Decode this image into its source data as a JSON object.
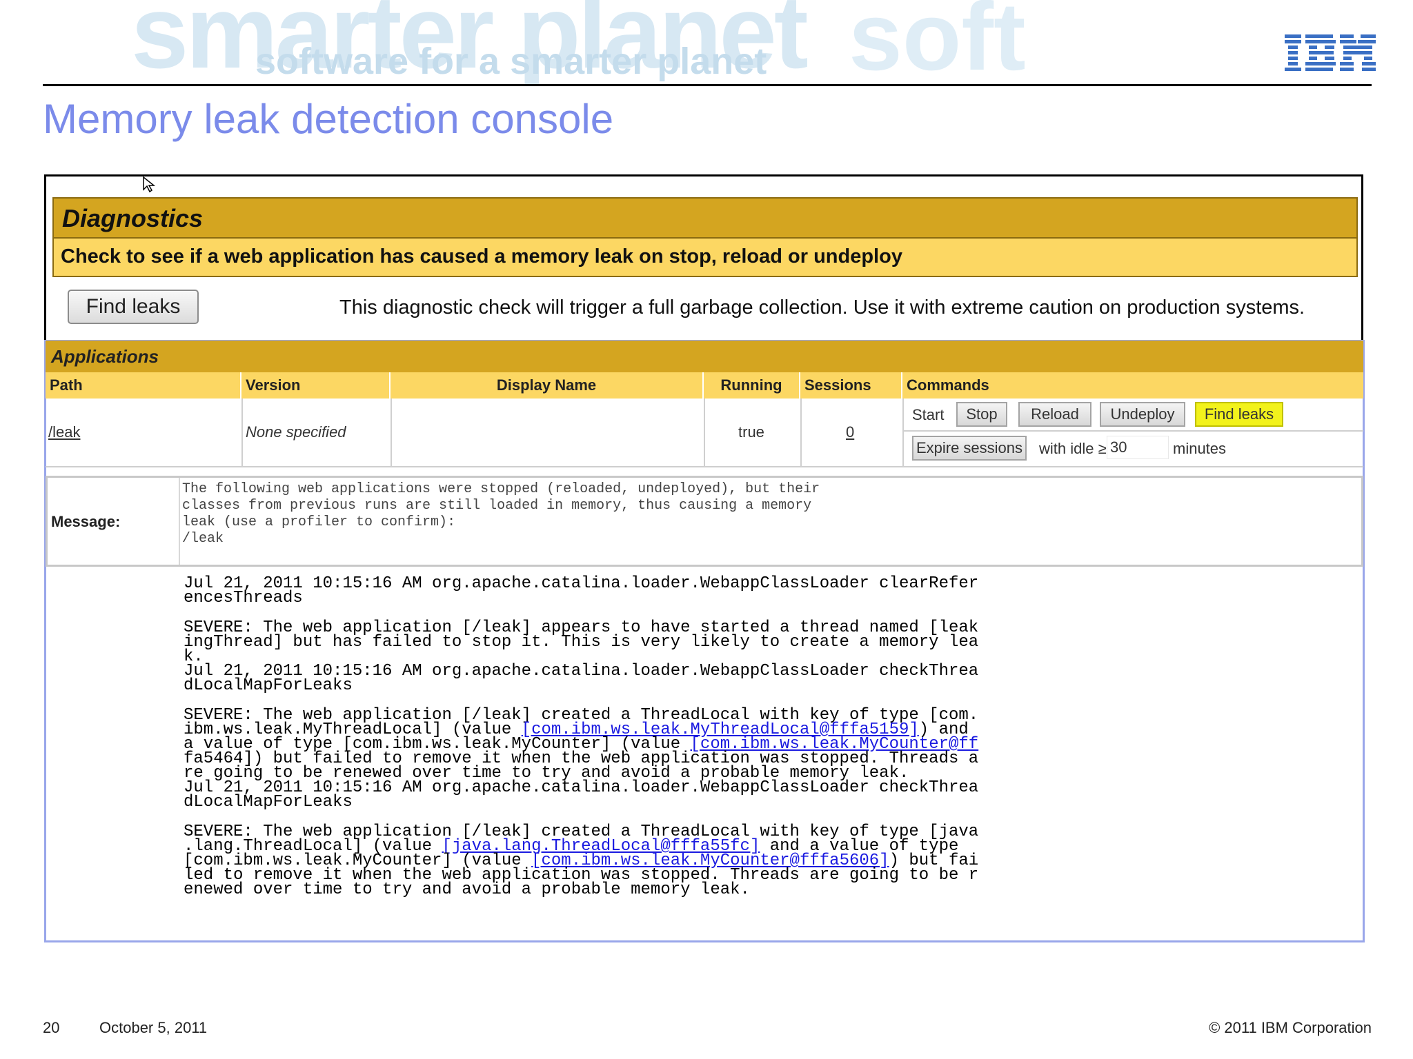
{
  "header": {
    "watermark_big": "smarter planet",
    "watermark_small": "software for a smarter planet",
    "watermark_right": "soft",
    "logo": "IBM",
    "title": "Memory leak detection console"
  },
  "diagnostics": {
    "heading": "Diagnostics",
    "subheading": "Check to see if a web application has caused a memory leak on stop, reload or undeploy",
    "find_leaks_label": "Find leaks",
    "note": "This diagnostic check will trigger a full garbage collection. Use it with extreme caution on production systems."
  },
  "applications": {
    "heading": "Applications",
    "columns": [
      "Path",
      "Version",
      "Display Name",
      "Running",
      "Sessions",
      "Commands"
    ],
    "row": {
      "path": "/leak",
      "version": "None specified",
      "display_name": "",
      "running": "true",
      "sessions": "0"
    },
    "commands": {
      "start": "Start",
      "stop": "Stop",
      "reload": "Reload",
      "undeploy": "Undeploy",
      "find_leaks": "Find leaks",
      "expire_sessions": "Expire sessions",
      "with_idle": "with idle ≥",
      "idle_value": "30",
      "minutes": "minutes"
    }
  },
  "message": {
    "label": "Message:",
    "text": "The following web applications were stopped (reloaded, undeployed), but their\nclasses from previous runs are still loaded in memory, thus causing a memory\nleak (use a profiler to confirm):\n/leak"
  },
  "log": {
    "entry1": "Jul 21, 2011 10:15:16 AM org.apache.catalina.loader.WebappClassLoader clearRefer\nencesThreads",
    "entry2": "SEVERE: The web application [/leak] appears to have started a thread named [leak\ningThread] but has failed to stop it. This is very likely to create a memory lea\nk.\nJul 21, 2011 10:15:16 AM org.apache.catalina.loader.WebappClassLoader checkThrea\ndLocalMapForLeaks",
    "e3_a": "SEVERE: The web application [/leak] created a ThreadLocal with key of type [com.\nibm.ws.leak.MyThreadLocal] (value ",
    "e3_l1": "[com.ibm.ws.leak.MyThreadLocal@fffa5159]",
    "e3_b": ") and\na value of type [com.ibm.ws.leak.MyCounter] (value ",
    "e3_l2": "[com.ibm.ws.leak.MyCounter@ff",
    "e3_c": "\nfa5464]) but failed to remove it when the web application was stopped. Threads a\nre going to be renewed over time to try and avoid a probable memory leak.\nJul 21, 2011 10:15:16 AM org.apache.catalina.loader.WebappClassLoader checkThrea\ndLocalMapForLeaks",
    "e4_a": "SEVERE: The web application [/leak] created a ThreadLocal with key of type [java\n.lang.ThreadLocal] (value ",
    "e4_l1": "[java.lang.ThreadLocal@fffa55fc]",
    "e4_b": " and a value of type\n[com.ibm.ws.leak.MyCounter] (value ",
    "e4_l2": "[com.ibm.ws.leak.MyCounter@fffa5606]",
    "e4_c": ") but fai\nled to remove it when the web application was stopped. Threads are going to be r\nenewed over time to try and avoid a probable memory leak."
  },
  "footer": {
    "page": "20",
    "date": "October 5, 2011",
    "copyright": "© 2011 IBM Corporation"
  },
  "colors": {
    "title": "#7b8bea",
    "header_gold": "#d4a520",
    "header_light": "#fcd763",
    "link_blue": "#1a1ae0",
    "frame_border": "#99a6ea"
  },
  "icons": [
    "ibm-logo-icon",
    "cursor-icon"
  ]
}
